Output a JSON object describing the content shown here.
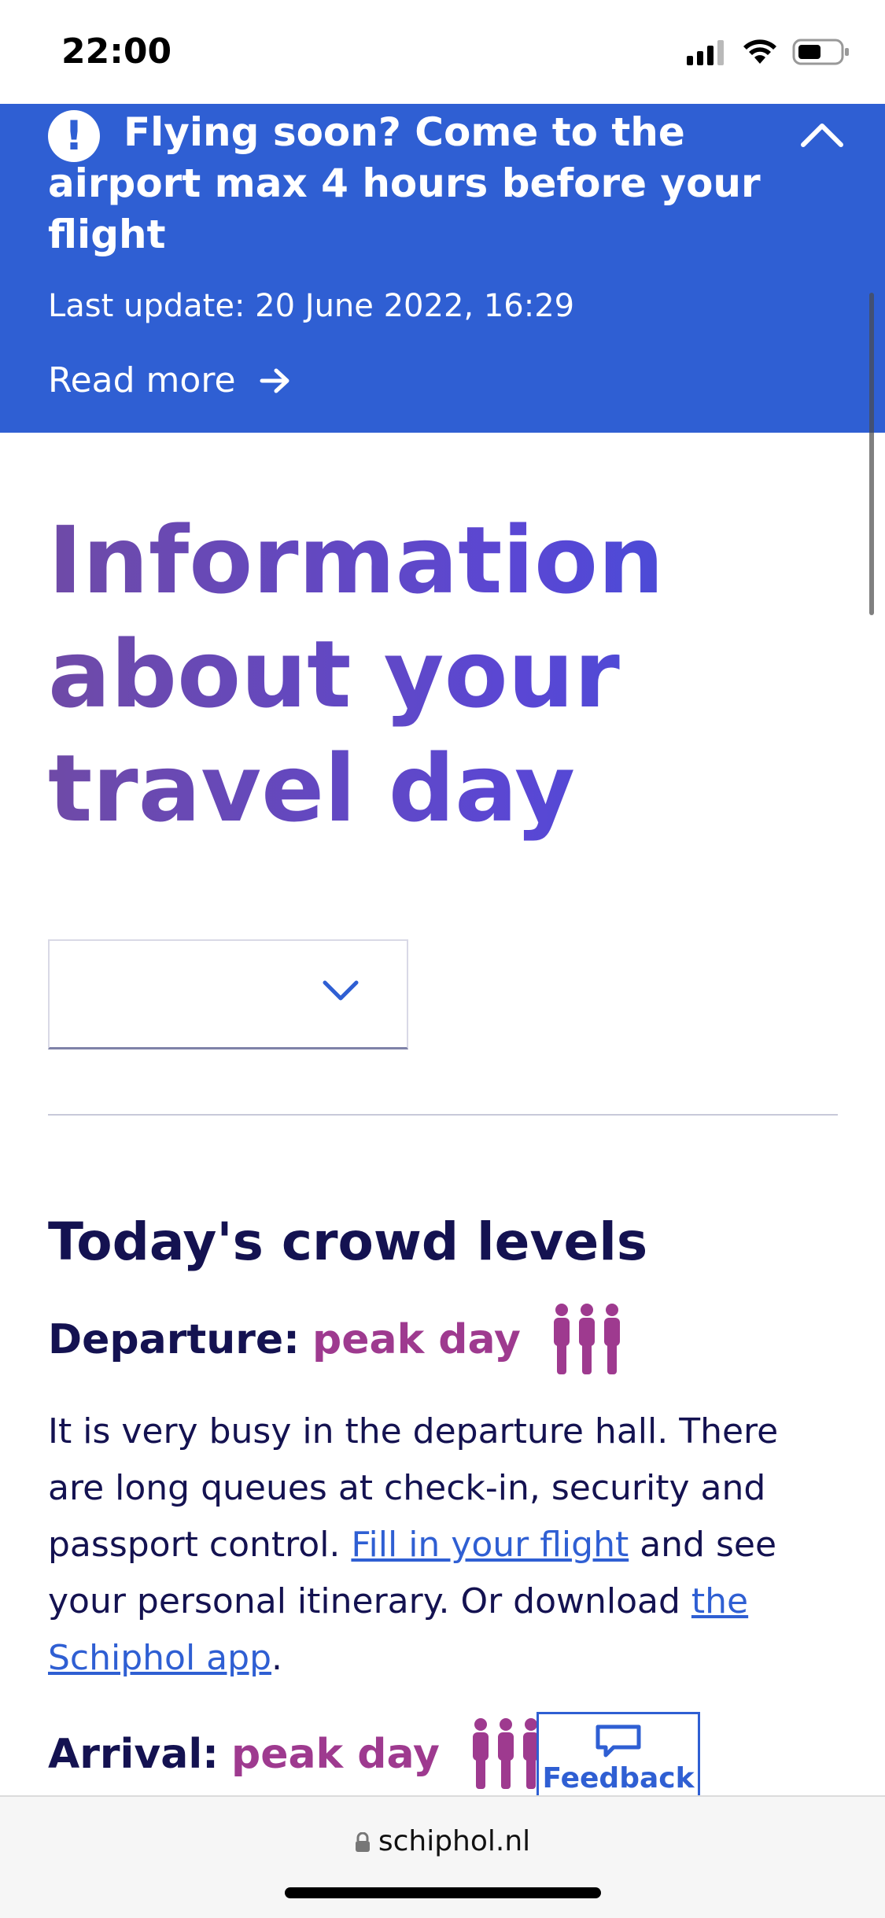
{
  "status_bar": {
    "time": "22:00"
  },
  "banner": {
    "title": "Flying soon? Come to the airport max 4 hours before your flight",
    "last_update": "Last update: 20 June 2022, 16:29",
    "read_more": "Read more",
    "background_color": "#2f5fd3"
  },
  "page": {
    "title": "Information about your travel day"
  },
  "date_select": {
    "selected_value": ""
  },
  "crowd": {
    "heading": "Today's crowd levels",
    "departure_label": "Departure:",
    "departure_value": "peak day",
    "arrival_label": "Arrival:",
    "arrival_value": "peak day",
    "peak_color": "#9e3a8f",
    "text_1": "It is very busy in the departure hall. There are long queues at check-in, security and passport control. ",
    "link_flight": "Fill in your flight",
    "text_2": " and see your personal itinerary. Or download ",
    "link_app": "the Schiphol app",
    "text_3": "."
  },
  "feedback": {
    "label": "Feedback"
  },
  "browser": {
    "url": "schiphol.nl"
  }
}
